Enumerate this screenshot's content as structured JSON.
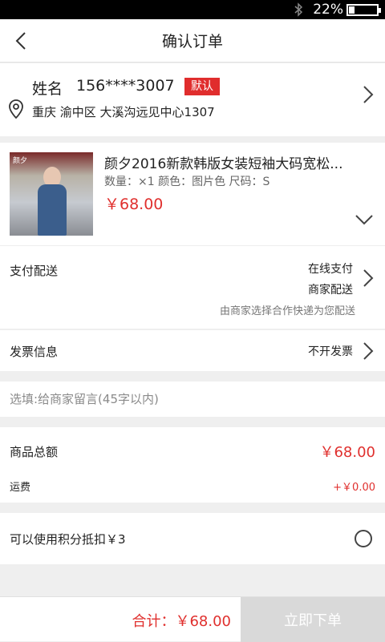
{
  "status_bar": {
    "battery_text": "22%",
    "battery_level": 0.22,
    "bluetooth_icon": "bluetooth-icon"
  },
  "header": {
    "title": "确认订单",
    "back_icon": "chevron-left-icon"
  },
  "address": {
    "name": "姓名",
    "phone": "156****3007",
    "badge": "默认",
    "line": "重庆 渝中区 大溪沟远见中心1307",
    "icons": [
      "location-pin-icon",
      "chevron-right-icon"
    ],
    "colors": {
      "badge": "#e02d2d"
    }
  },
  "product": {
    "title": "颜夕2016新款韩版女装短袖大码宽松...",
    "specs": "数量：×1 颜色：图片色 尺码：S",
    "price": "￥68.00",
    "thumb_brand": "颜夕",
    "icons": [
      "chevron-down-icon"
    ]
  },
  "delivery": {
    "label": "支付配送",
    "payment": "在线支付",
    "shipping": "商家配送",
    "note": "由商家选择合作快递为您配送"
  },
  "invoice": {
    "label": "发票信息",
    "value": "不开发票"
  },
  "message": {
    "placeholder": "选填:给商家留言(45字以内)"
  },
  "totals": {
    "subtotal_label": "商品总额",
    "subtotal_value": "￥68.00",
    "shipping_label": "运费",
    "shipping_value": "+￥0.00"
  },
  "points": {
    "label": "可以使用积分抵扣￥3",
    "selected": false
  },
  "footer": {
    "total": "合计：￥68.00",
    "submit_label": "立即下单"
  },
  "theme": {
    "accent": "#e0302e",
    "disabled_button": "#d9d9d9"
  }
}
